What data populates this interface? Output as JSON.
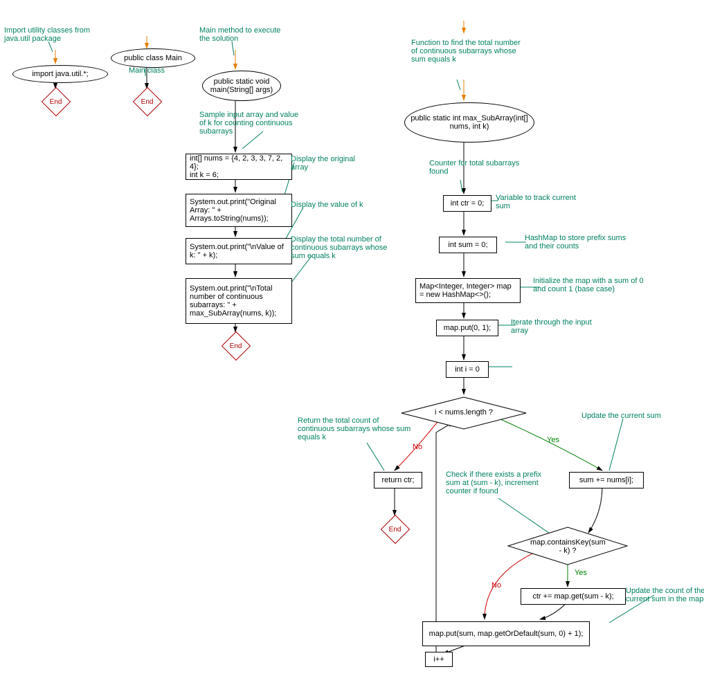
{
  "comments": {
    "c1": "Import utility classes from java.util package",
    "c2": "Main class",
    "c3": "Main method to execute the solution",
    "c4": "Sample input array and value of k for counting continuous subarrays",
    "c5": "Display the original array",
    "c6": "Display the value of k",
    "c7": "Display the total number of continuous subarrays whose sum equals k",
    "c8": "Function to find the total number of continuous subarrays whose sum equals k",
    "c9": "Counter for total subarrays found",
    "c10": "Variable to track current sum",
    "c11": "HashMap to store prefix sums and their counts",
    "c12": "Initialize the map with a sum of 0 and count 1 (base case)",
    "c13": "Iterate through the input array",
    "c14": "Return the total count of continuous subarrays whose sum equals k",
    "c15": "Update the current sum",
    "c16": "Check if there exists a prefix sum at (sum - k), increment counter if found",
    "c17": "Update the count of the current sum in the map"
  },
  "nodes": {
    "import": "import java.util.*;",
    "class": "public class Main",
    "main": "public static void main(String[] args)",
    "nums": "int[] nums = {4, 2, 3, 3, 7, 2, 4};\nint k = 6;",
    "print1": "System.out.print(\"Original Array: \" + Arrays.toString(nums));",
    "print2": "System.out.print(\"\\nValue of k: \" + k);",
    "print3": "System.out.print(\"\\nTotal number of continuous subarrays: \" + max_SubArray(nums, k));",
    "func": "public static int max_SubArray(int[] nums, int k)",
    "ctr": "int ctr = 0;",
    "sum": "int sum = 0;",
    "map": "Map<Integer, Integer> map = new HashMap<>();",
    "put0": "map.put(0, 1);",
    "i0": "int i = 0",
    "cond1": "i < nums.length ?",
    "ret": "return ctr;",
    "sumadd": "sum += nums[i];",
    "cond2": "map.containsKey(sum - k) ?",
    "ctradd": "ctr += map.get(sum - k);",
    "mapput": "map.put(sum, map.getOrDefault(sum, 0) + 1);",
    "ipp": "i++",
    "end": "End"
  },
  "labels": {
    "yes": "Yes",
    "no": "No"
  }
}
